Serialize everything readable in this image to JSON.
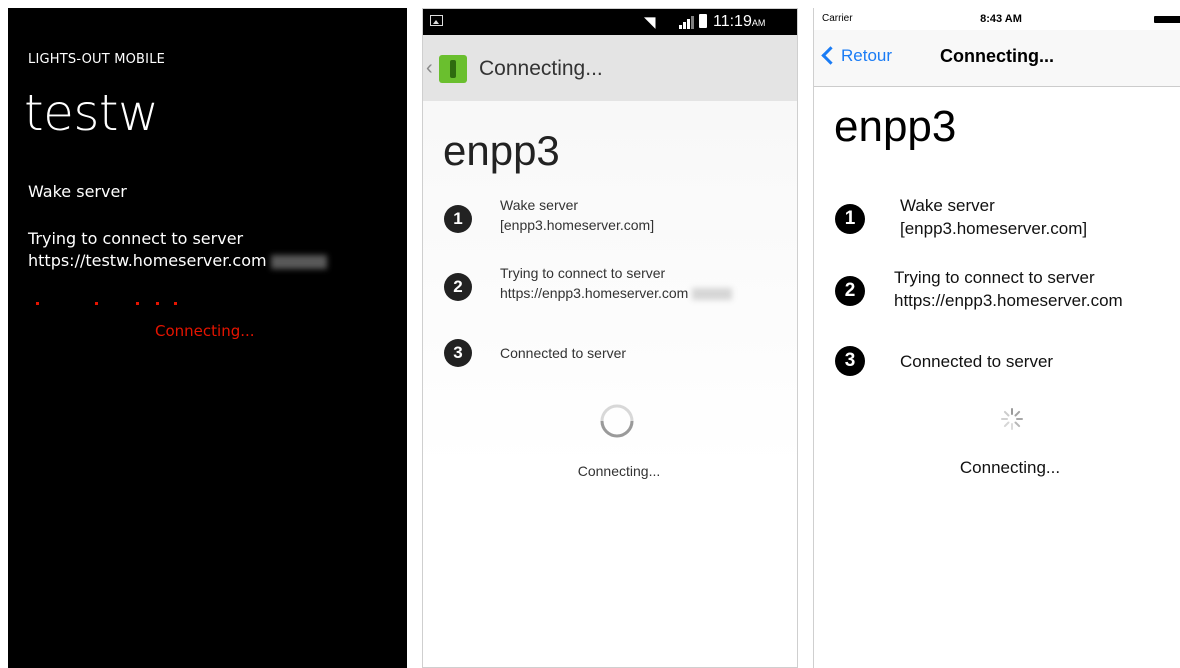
{
  "windows_phone": {
    "app_name": "LIGHTS-OUT MOBILE",
    "server_name": "testw",
    "step1": "Wake server",
    "step2_line1": "Trying to connect to server",
    "step2_line2": "https://testw.homeserver.com",
    "status": "Connecting...",
    "accent_color": "#e51400"
  },
  "android": {
    "status_bar": {
      "time": "11:19",
      "ampm": "AM",
      "icons": [
        "image-icon",
        "wifi-icon",
        "signal-icon",
        "battery-icon"
      ]
    },
    "action_bar_title": "Connecting...",
    "server_name": "enpp3",
    "steps": [
      {
        "number": "1",
        "line1": "Wake server",
        "line2": "[enpp3.homeserver.com]"
      },
      {
        "number": "2",
        "line1": "Trying to connect to server",
        "line2": "https://enpp3.homeserver.com"
      },
      {
        "number": "3",
        "line1": "Connected to server",
        "line2": ""
      }
    ],
    "status": "Connecting..."
  },
  "ios": {
    "status_bar": {
      "carrier": "Carrier",
      "time": "8:43 AM"
    },
    "back_label": "Retour",
    "nav_title": "Connecting...",
    "server_name": "enpp3",
    "steps": [
      {
        "number": "1",
        "line1": "Wake server",
        "line2": "[enpp3.homeserver.com]"
      },
      {
        "number": "2",
        "line1": "Trying to connect to server",
        "line2": "https://enpp3.homeserver.com"
      },
      {
        "number": "3",
        "line1": "Connected to server",
        "line2": ""
      }
    ],
    "status": "Connecting...",
    "accent_color": "#1a7cf5"
  }
}
